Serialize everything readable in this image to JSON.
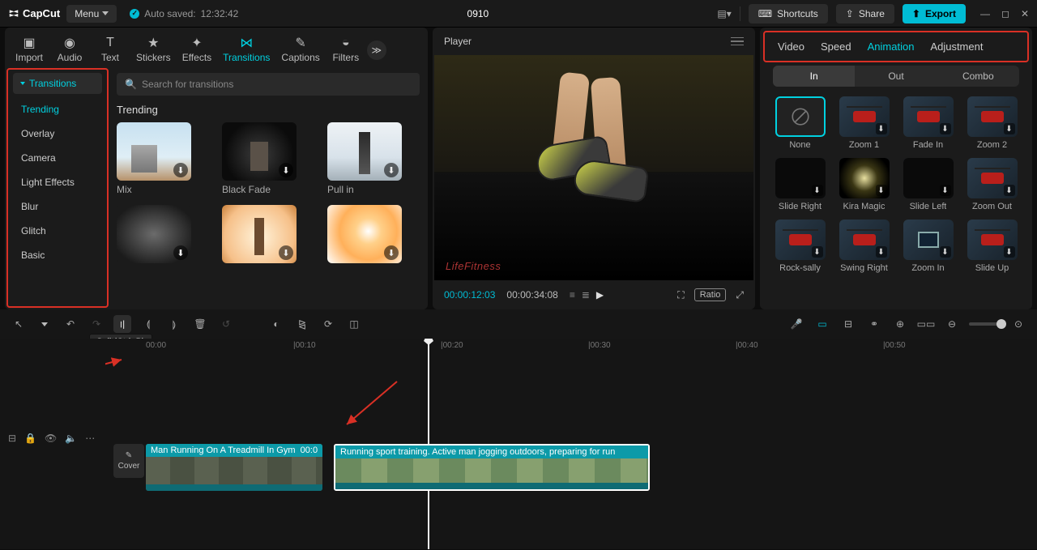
{
  "title_bar": {
    "app": "CapCut",
    "menu": "Menu",
    "autosave_prefix": "Auto saved:",
    "autosave_time": "12:32:42",
    "project": "0910",
    "shortcuts": "Shortcuts",
    "share": "Share",
    "export": "Export"
  },
  "top_tabs": [
    "Import",
    "Audio",
    "Text",
    "Stickers",
    "Effects",
    "Transitions",
    "Captions",
    "Filters"
  ],
  "top_tabs_active_index": 5,
  "sidebar": {
    "group": "Transitions",
    "items": [
      "Trending",
      "Overlay",
      "Camera",
      "Light Effects",
      "Blur",
      "Glitch",
      "Basic"
    ],
    "active_index": 0
  },
  "search_placeholder": "Search for transitions",
  "assets_heading": "Trending",
  "asset_cards": [
    {
      "name": "Mix",
      "variant": "sky"
    },
    {
      "name": "Black Fade",
      "variant": "darkfade"
    },
    {
      "name": "Pull in",
      "variant": "pullin"
    },
    {
      "name": "",
      "variant": "motion"
    },
    {
      "name": "",
      "variant": "warm"
    },
    {
      "name": "",
      "variant": "glow"
    }
  ],
  "player": {
    "title": "Player",
    "current": "00:00:12:03",
    "total": "00:00:34:08",
    "ratio": "Ratio"
  },
  "right": {
    "tabs": [
      "Video",
      "Speed",
      "Animation",
      "Adjustment"
    ],
    "active_tab_index": 2,
    "sub_tabs": [
      "In",
      "Out",
      "Combo"
    ],
    "sub_active_index": 0,
    "anims": [
      {
        "name": "None",
        "kind": "none",
        "selected": true
      },
      {
        "name": "Zoom 1",
        "kind": "cable"
      },
      {
        "name": "Fade In",
        "kind": "cable"
      },
      {
        "name": "Zoom 2",
        "kind": "cable"
      },
      {
        "name": "Slide Right",
        "kind": "dark"
      },
      {
        "name": "Kira Magic",
        "kind": "sparkle"
      },
      {
        "name": "Slide Left",
        "kind": "dark"
      },
      {
        "name": "Zoom Out",
        "kind": "cable"
      },
      {
        "name": "Rock-sally",
        "kind": "cable"
      },
      {
        "name": "Swing Right",
        "kind": "cable"
      },
      {
        "name": "Zoom In",
        "kind": "box"
      },
      {
        "name": "Slide Up",
        "kind": "cable"
      }
    ]
  },
  "toolbar_tooltip": "Split(Ctrl+B)",
  "ruler_marks": [
    {
      "pos": 50,
      "label": "00:00"
    },
    {
      "pos": 232,
      "label": "|00:10"
    },
    {
      "pos": 414,
      "label": "|00:20"
    },
    {
      "pos": 596,
      "label": "|00:30"
    },
    {
      "pos": 778,
      "label": "|00:40"
    },
    {
      "pos": 960,
      "label": "|00:50"
    }
  ],
  "clips": {
    "c1_label": "Man Running On A Treadmill In Gym",
    "c1_time": "00:0",
    "c2_label": "Running sport training. Active man jogging outdoors, preparing for run"
  },
  "cover_label": "Cover",
  "treadmill_brand": "LifeFitness"
}
